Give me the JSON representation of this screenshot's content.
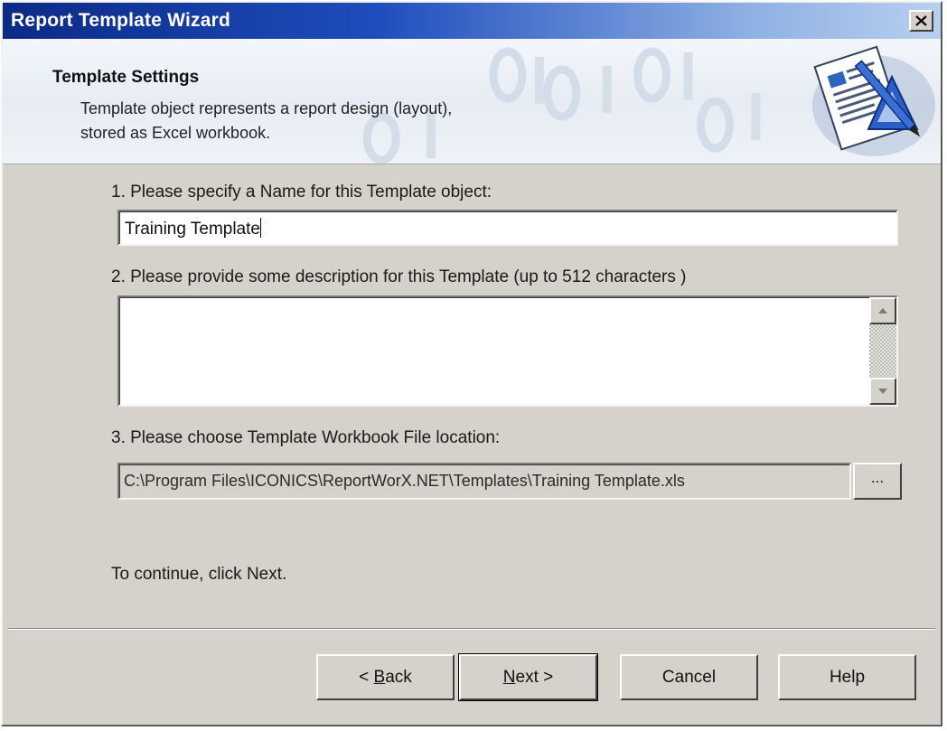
{
  "window": {
    "title": "Report Template Wizard"
  },
  "header": {
    "title": "Template Settings",
    "description_line1": "Template object represents a report design (layout),",
    "description_line2": "stored as Excel workbook."
  },
  "step1": {
    "label": "1. Please specify a Name for this Template object:",
    "value": "Training Template"
  },
  "step2": {
    "label": "2. Please provide some description for this Template (up to 512 characters )",
    "value": ""
  },
  "step3": {
    "label": "3. Please choose Template Workbook File location:",
    "value": "C:\\Program Files\\ICONICS\\ReportWorX.NET\\Templates\\Training Template.xls",
    "browse_label": "..."
  },
  "hint": "To continue, click Next.",
  "buttons": {
    "back_prefix": "< ",
    "back_mnemonic": "B",
    "back_rest": "ack",
    "next_mnemonic": "N",
    "next_rest": "ext >",
    "cancel": "Cancel",
    "help": "Help"
  },
  "icons": {
    "close": "close-icon",
    "wizard": "wizard-document-pen-icon",
    "scroll_up": "arrow-up-icon",
    "scroll_down": "arrow-down-icon"
  },
  "colors": {
    "title_bar_start": "#0b2a86",
    "title_bar_end": "#b9cfee",
    "dialog_face": "#d5d2cb"
  }
}
